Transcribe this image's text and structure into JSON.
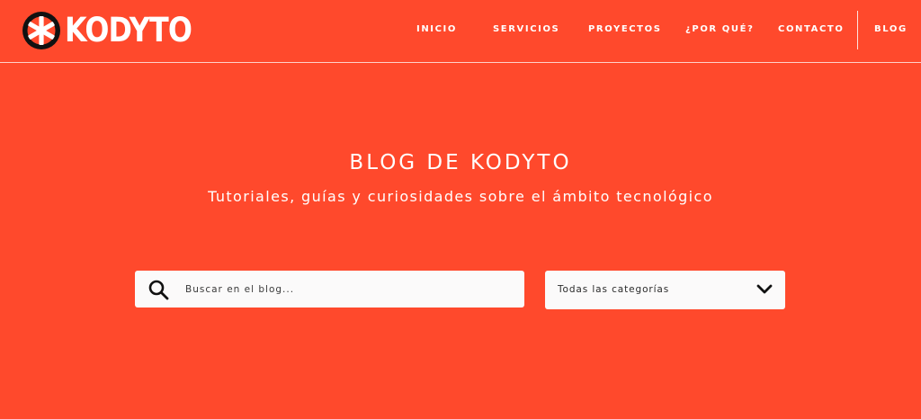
{
  "brand": {
    "name": "KODYTO",
    "logo_icon": "asterisk-logo-icon",
    "background_color": "#ff492c"
  },
  "nav": {
    "items": [
      {
        "label": "INICIO"
      },
      {
        "label": "SERVICIOS"
      },
      {
        "label": "PROYECTOS"
      },
      {
        "label": "¿POR QUÉ?"
      },
      {
        "label": "CONTACTO"
      },
      {
        "label": "BLOG"
      }
    ]
  },
  "hero": {
    "title": "BLOG DE KODYTO",
    "subtitle": "Tutoriales, guías y curiosidades sobre el ámbito tecnológico"
  },
  "search": {
    "icon": "search-icon",
    "placeholder": "Buscar en el blog...",
    "value": ""
  },
  "category_filter": {
    "selected": "Todas las categorías",
    "icon": "chevron-down-icon"
  }
}
